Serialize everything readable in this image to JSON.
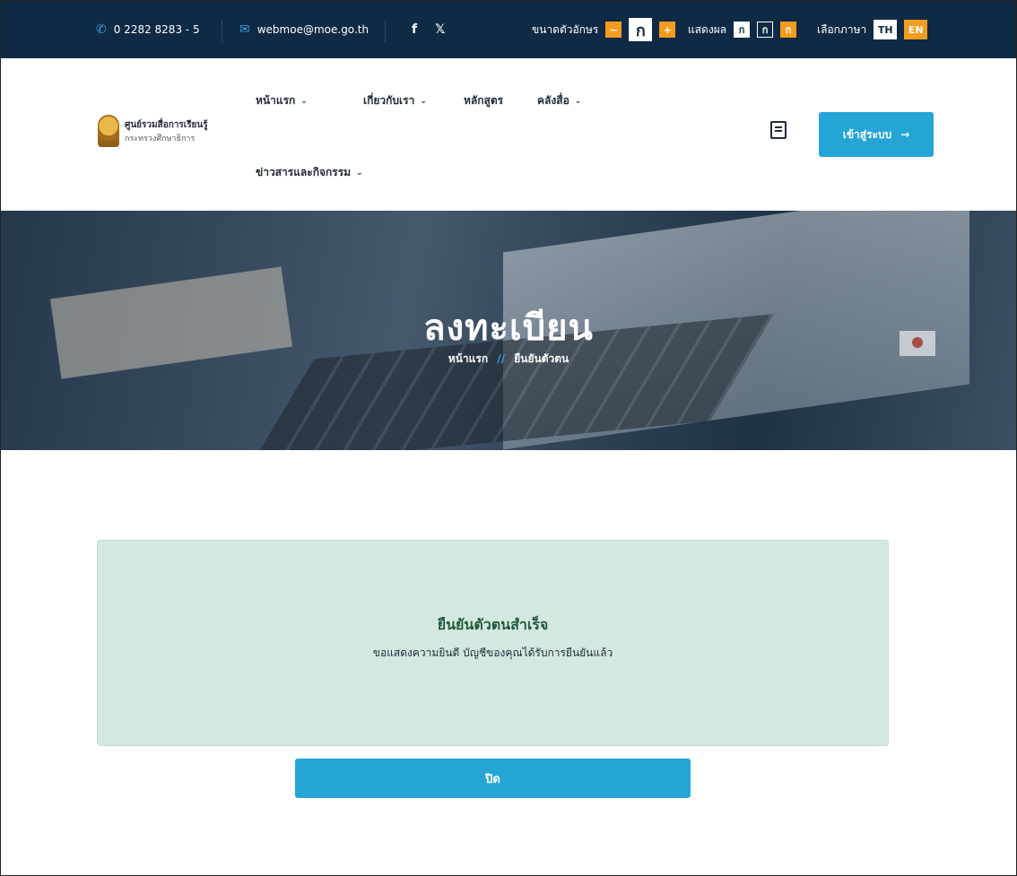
{
  "topbar": {
    "phone": "0 2282 8283 - 5",
    "email": "webmoe@moe.go.th",
    "social": [
      "f",
      "𝕏"
    ],
    "font_size_label": "ขนาดตัวอักษร",
    "font_size_buttons": [
      "−",
      "ก",
      "+"
    ],
    "display_label": "แสดงผล",
    "display_buttons": [
      "ก",
      "ก",
      "ก"
    ],
    "language_label": "เลือกภาษา",
    "languages": [
      "TH",
      "EN"
    ]
  },
  "header": {
    "logo_line1": "ศูนย์รวมสื่อการเรียนรู้",
    "logo_line2": "กระทรวงศึกษาธิการ",
    "nav": [
      {
        "label": "หน้าแรก",
        "dropdown": true
      },
      {
        "label": "เกี่ยวกับเรา",
        "dropdown": true
      },
      {
        "label": "หลักสูตร",
        "dropdown": false
      },
      {
        "label": "คลังสื่อ",
        "dropdown": true
      },
      {
        "label": "ข่าวสารและกิจกรรม",
        "dropdown": true
      }
    ],
    "login_label": "เข้าสู่ระบบ",
    "login_arrow": "→"
  },
  "hero": {
    "title": "ลงทะเบียน",
    "breadcrumb_home": "หน้าแรก",
    "breadcrumb_sep": "//",
    "breadcrumb_current": "ยืนยันตัวตน"
  },
  "success": {
    "title": "ยืนยันตัวตนสำเร็จ",
    "message": "ขอแสดงความยินดี บัญชีของคุณได้รับการยืนยันแล้ว"
  },
  "close_button": "ปิด",
  "colors": {
    "topbar": "#0f2a45",
    "accent_blue": "#25a5d6",
    "accent_orange": "#f39c1f",
    "success_bg": "#d4e8df",
    "success_title": "#1f5a36"
  },
  "icons": [
    "phone-icon",
    "mail-icon",
    "facebook-icon",
    "twitter-icon",
    "chevron-down-icon",
    "book-icon",
    "arrow-right-icon"
  ]
}
